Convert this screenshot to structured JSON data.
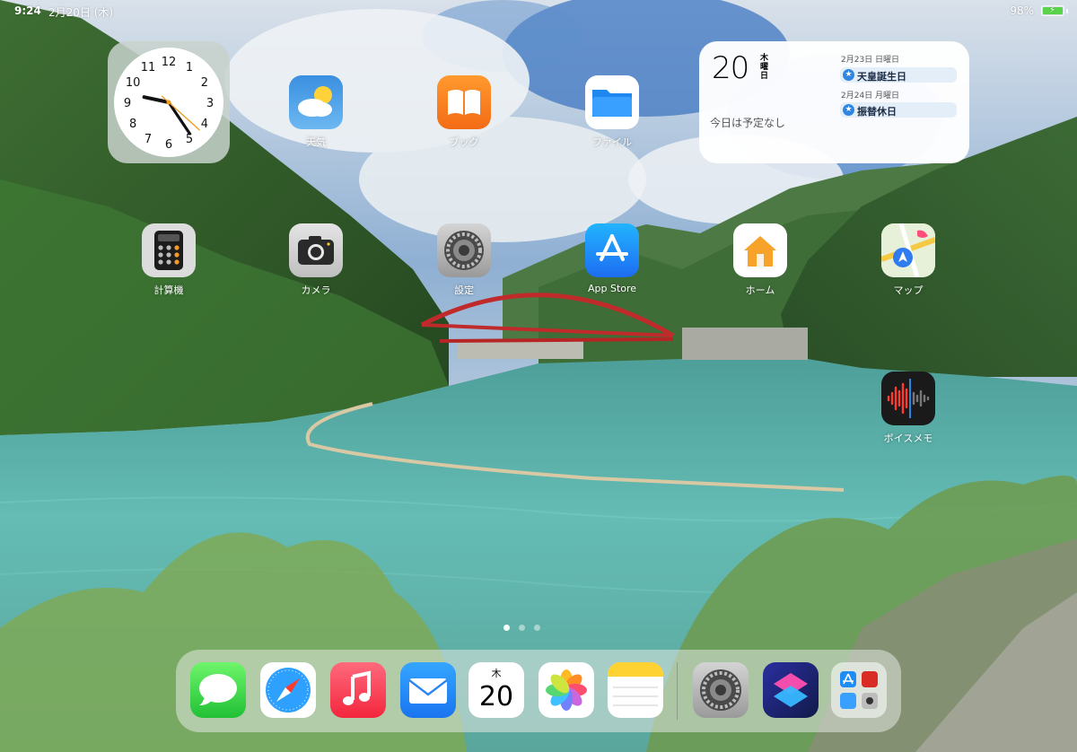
{
  "status_bar": {
    "time": "9:24",
    "date": "2月20日 (木)",
    "battery_percent": "98%",
    "battery_level": 0.98,
    "charging": true,
    "battery_color": "#5ad44a"
  },
  "clock_widget": {
    "hour": 9,
    "minute": 24,
    "second": 22,
    "numerals": [
      "12",
      "1",
      "2",
      "3",
      "4",
      "5",
      "6",
      "7",
      "8",
      "9",
      "10",
      "11"
    ]
  },
  "calendar_widget": {
    "day_number": "20",
    "weekday": "木曜日",
    "no_events_text": "今日は予定なし",
    "events": [
      {
        "date": "2月23日 日曜日",
        "title": "天皇誕生日",
        "icon": "star-icon"
      },
      {
        "date": "2月24日 月曜日",
        "title": "振替休日",
        "icon": "star-icon"
      }
    ]
  },
  "apps": [
    {
      "name": "weather",
      "label": "天気",
      "icon": "weather-icon"
    },
    {
      "name": "books",
      "label": "ブック",
      "icon": "book-icon"
    },
    {
      "name": "files",
      "label": "ファイル",
      "icon": "folder-icon"
    },
    {
      "name": "calculator",
      "label": "計算機",
      "icon": "calculator-icon"
    },
    {
      "name": "camera",
      "label": "カメラ",
      "icon": "camera-icon"
    },
    {
      "name": "settings",
      "label": "設定",
      "icon": "gear-icon"
    },
    {
      "name": "app-store",
      "label": "App Store",
      "icon": "app-store-icon"
    },
    {
      "name": "home",
      "label": "ホーム",
      "icon": "house-icon"
    },
    {
      "name": "maps",
      "label": "マップ",
      "icon": "map-icon"
    },
    {
      "name": "voice-memos",
      "label": "ボイスメモ",
      "icon": "waveform-icon"
    }
  ],
  "page_indicator": {
    "count": 3,
    "current": 1
  },
  "dock": {
    "apps": [
      {
        "name": "messages",
        "icon": "messages-icon"
      },
      {
        "name": "safari",
        "icon": "compass-icon"
      },
      {
        "name": "music",
        "icon": "music-note-icon"
      },
      {
        "name": "mail",
        "icon": "envelope-icon"
      },
      {
        "name": "calendar",
        "icon": "calendar-icon",
        "weekday": "木",
        "day": "20"
      },
      {
        "name": "photos",
        "icon": "photos-flower-icon"
      },
      {
        "name": "notes",
        "icon": "notes-icon"
      },
      {
        "name": "settings",
        "icon": "gear-icon"
      },
      {
        "name": "shortcuts",
        "icon": "shortcuts-icon"
      },
      {
        "name": "app-library",
        "icon": "app-library-icon"
      }
    ]
  },
  "colors": {
    "accent_blue": "#2f86e0",
    "calendar_event_bg": "#e3eef9",
    "clock_second_hand": "#f09a1a"
  }
}
